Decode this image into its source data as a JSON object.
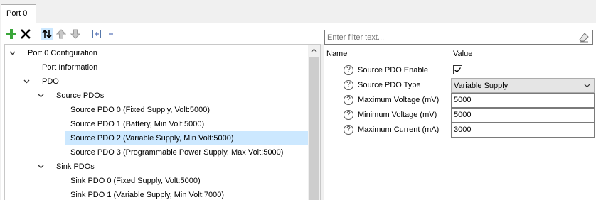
{
  "tabs": [
    {
      "label": "Port 0",
      "selected": true
    }
  ],
  "toolbar": {
    "buttons": [
      {
        "icon": "add-icon",
        "color": "#3aa63a"
      },
      {
        "icon": "delete-icon",
        "color": "#000000"
      },
      {
        "icon": "sort-icon",
        "active": true
      },
      {
        "icon": "move-up-icon"
      },
      {
        "icon": "move-down-icon"
      },
      {
        "icon": "expand-all-icon"
      },
      {
        "icon": "collapse-all-icon"
      }
    ]
  },
  "tree": {
    "items": [
      {
        "label": "Port 0 Configuration",
        "expanded": true
      },
      {
        "label": "Port Information"
      },
      {
        "label": "PDO",
        "expanded": true
      },
      {
        "label": "Source PDOs",
        "expanded": true
      },
      {
        "label": "Source PDO 0 (Fixed Supply, Volt:5000)"
      },
      {
        "label": "Source PDO 1 (Battery, Min Volt:5000)"
      },
      {
        "label": "Source PDO 2 (Variable Supply, Min Volt:5000)",
        "selected": true
      },
      {
        "label": "Source PDO 3 (Programmable Power Supply, Max Volt:5000)"
      },
      {
        "label": "Sink PDOs",
        "expanded": true
      },
      {
        "label": "Sink PDO 0 (Fixed Supply, Volt:5000)"
      },
      {
        "label": "Sink PDO 1 (Variable Supply, Min Volt:7000)"
      }
    ],
    "selection_color": "#cce8ff"
  },
  "filter": {
    "placeholder": "Enter filter text...",
    "value": ""
  },
  "properties": {
    "headers": {
      "name": "Name",
      "value": "Value"
    },
    "help_glyph": "?",
    "rows": [
      {
        "name": "Source PDO Enable",
        "type": "checkbox",
        "checked": true
      },
      {
        "name": "Source PDO Type",
        "type": "combo",
        "value": "Variable Supply"
      },
      {
        "name": "Maximum Voltage (mV)",
        "type": "text",
        "value": "5000"
      },
      {
        "name": "Minimum Voltage (mV)",
        "type": "text",
        "value": "5000"
      },
      {
        "name": "Maximum Current (mA)",
        "type": "text",
        "value": "3000"
      }
    ]
  }
}
